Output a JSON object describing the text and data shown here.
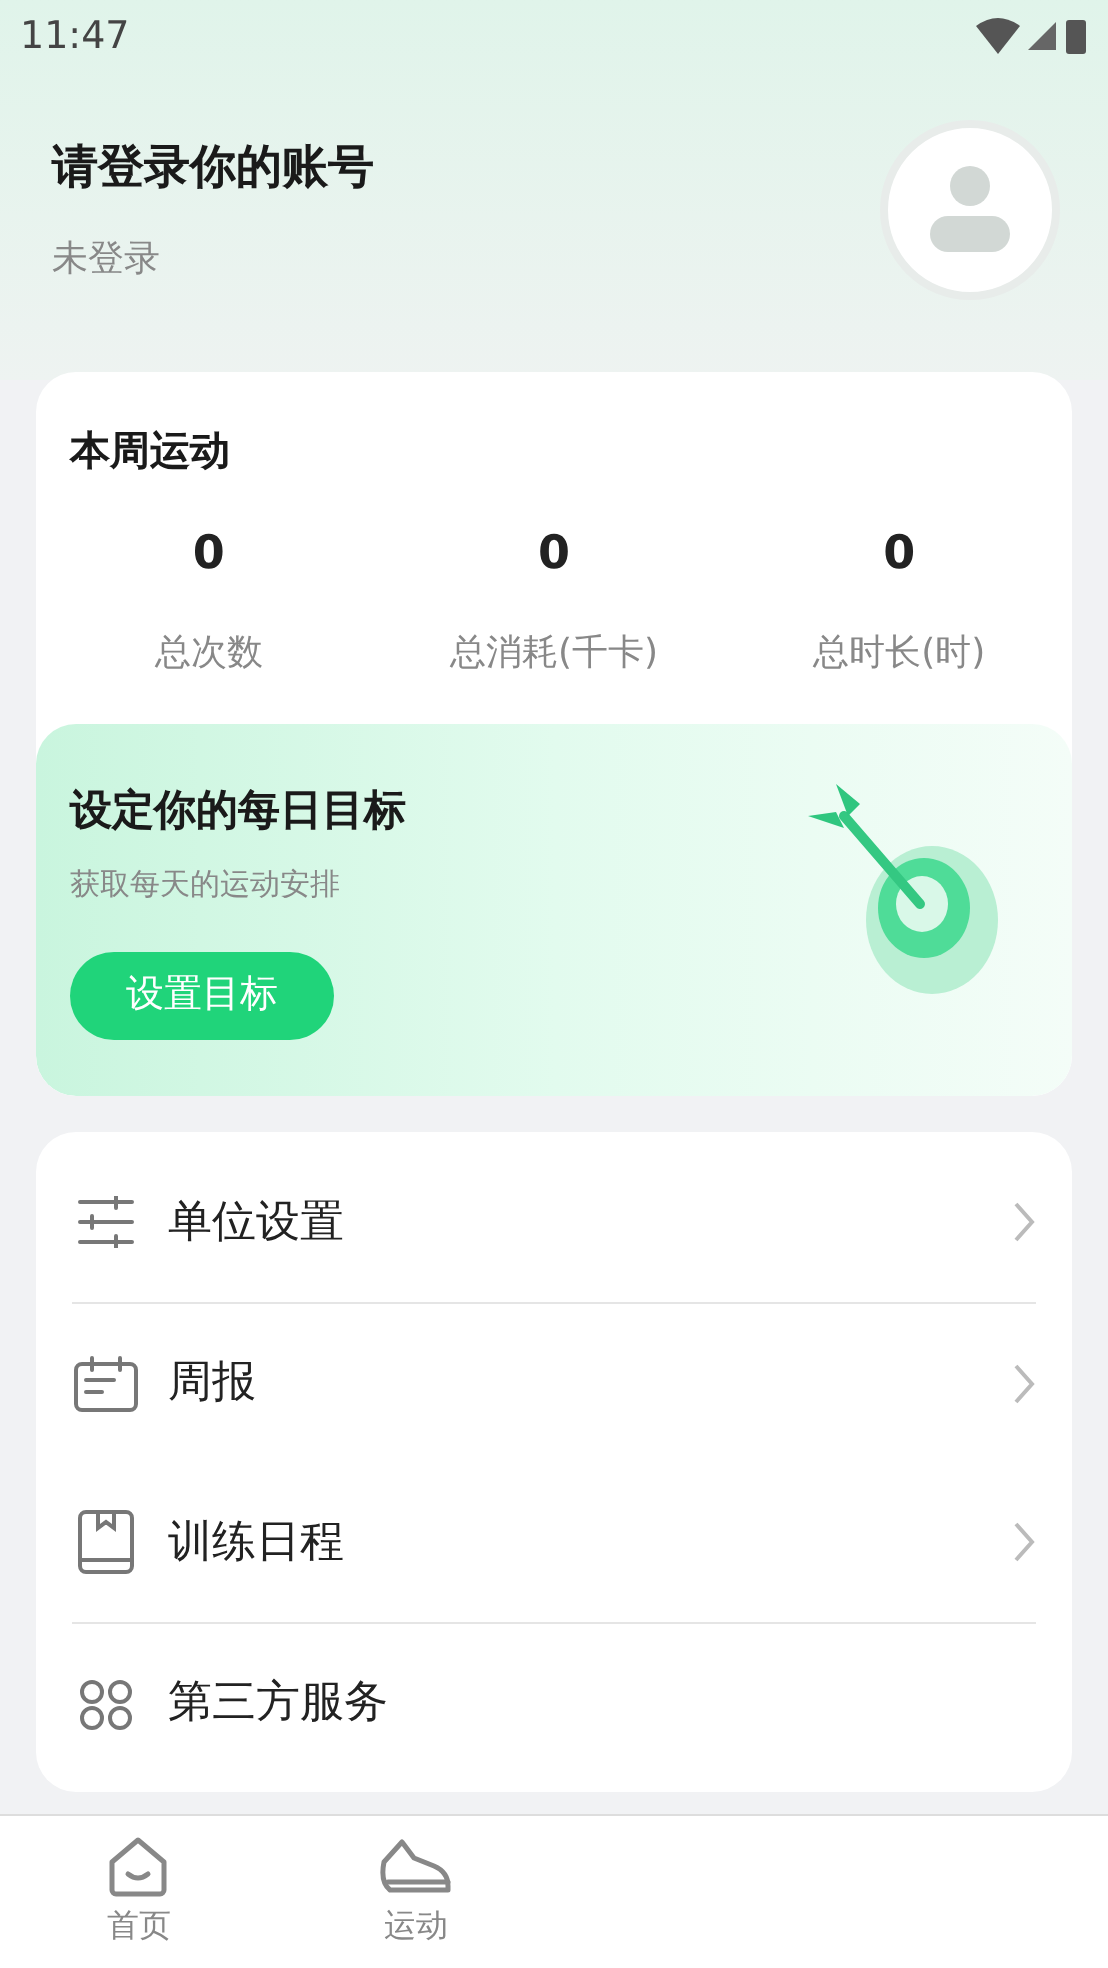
{
  "status_bar": {
    "time": "11:47"
  },
  "profile": {
    "title": "请登录你的账号",
    "subtitle": "未登录"
  },
  "weekly": {
    "title": "本周运动",
    "stats": [
      {
        "value": "0",
        "label": "总次数"
      },
      {
        "value": "0",
        "label": "总消耗(千卡)"
      },
      {
        "value": "0",
        "label": "总时长(时)"
      }
    ]
  },
  "goal": {
    "title": "设定你的每日目标",
    "subtitle": "获取每天的运动安排",
    "button": "设置目标"
  },
  "menu": [
    {
      "kind": "sliders",
      "label": "单位设置"
    },
    {
      "kind": "calendar",
      "label": "周报"
    },
    {
      "kind": "book",
      "label": "训练日程"
    },
    {
      "kind": "services",
      "label": "第三方服务"
    }
  ],
  "tabs": [
    {
      "kind": "home",
      "label": "首页",
      "selected": false
    },
    {
      "kind": "shoe",
      "label": "运动",
      "selected": false
    }
  ]
}
